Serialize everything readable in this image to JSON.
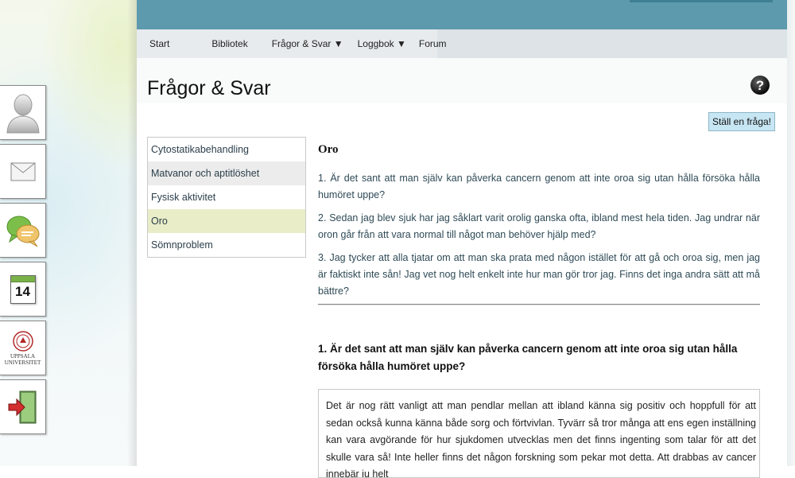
{
  "nav": {
    "items": [
      "Start",
      "Bibliotek",
      "Frågor & Svar ▼",
      "Loggbok ▼",
      "Forum"
    ]
  },
  "page": {
    "title": "Frågor & Svar",
    "ask_button": "Ställ en fråga!"
  },
  "sidebar": {
    "icons": [
      "user-icon",
      "mail-icon",
      "chat-icon",
      "calendar-icon",
      "uppsala-university-logo",
      "logout-icon"
    ],
    "calendar_day": "14",
    "university_name_line1": "UPPSALA",
    "university_name_line2": "UNIVERSITET"
  },
  "categories": [
    {
      "label": "Cytostatikabehandling"
    },
    {
      "label": "Matvanor och aptitlöshet"
    },
    {
      "label": "Fysisk aktivitet"
    },
    {
      "label": "Oro"
    },
    {
      "label": "Sömnproblem"
    }
  ],
  "content": {
    "heading": "Oro",
    "questions": [
      "1. Är det sant att man själv kan påverka cancern genom att inte oroa sig utan hålla försöka hålla humöret uppe?",
      "2. Sedan jag blev sjuk har jag såklart varit orolig ganska ofta, ibland mest hela tiden. Jag undrar när oron går från att vara normal till något man behöver hjälp med?",
      "3. Jag tycker att alla tjatar om att man ska prata med någon istället för att gå och oroa sig, men jag är faktiskt inte sån! Jag vet nog helt enkelt inte hur man gör tror jag. Finns det inga andra sätt att må bättre?"
    ],
    "answer_title": "1. Är det sant att man själv kan påverka cancern genom att inte oroa sig utan hålla försöka hålla humöret uppe?",
    "answer_text": "Det är nog rätt vanligt att man pendlar mellan att ibland känna sig positiv och hoppfull för att sedan också kunna känna både sorg och förtvivlan. Tyvärr så tror många att ens egen inställning kan vara avgörande för hur sjukdomen utvecklas men det finns ingenting som talar för att det skulle vara så! Inte heller finns det någon forskning som pekar mot detta. Att drabbas av cancer innebär ju helt"
  }
}
